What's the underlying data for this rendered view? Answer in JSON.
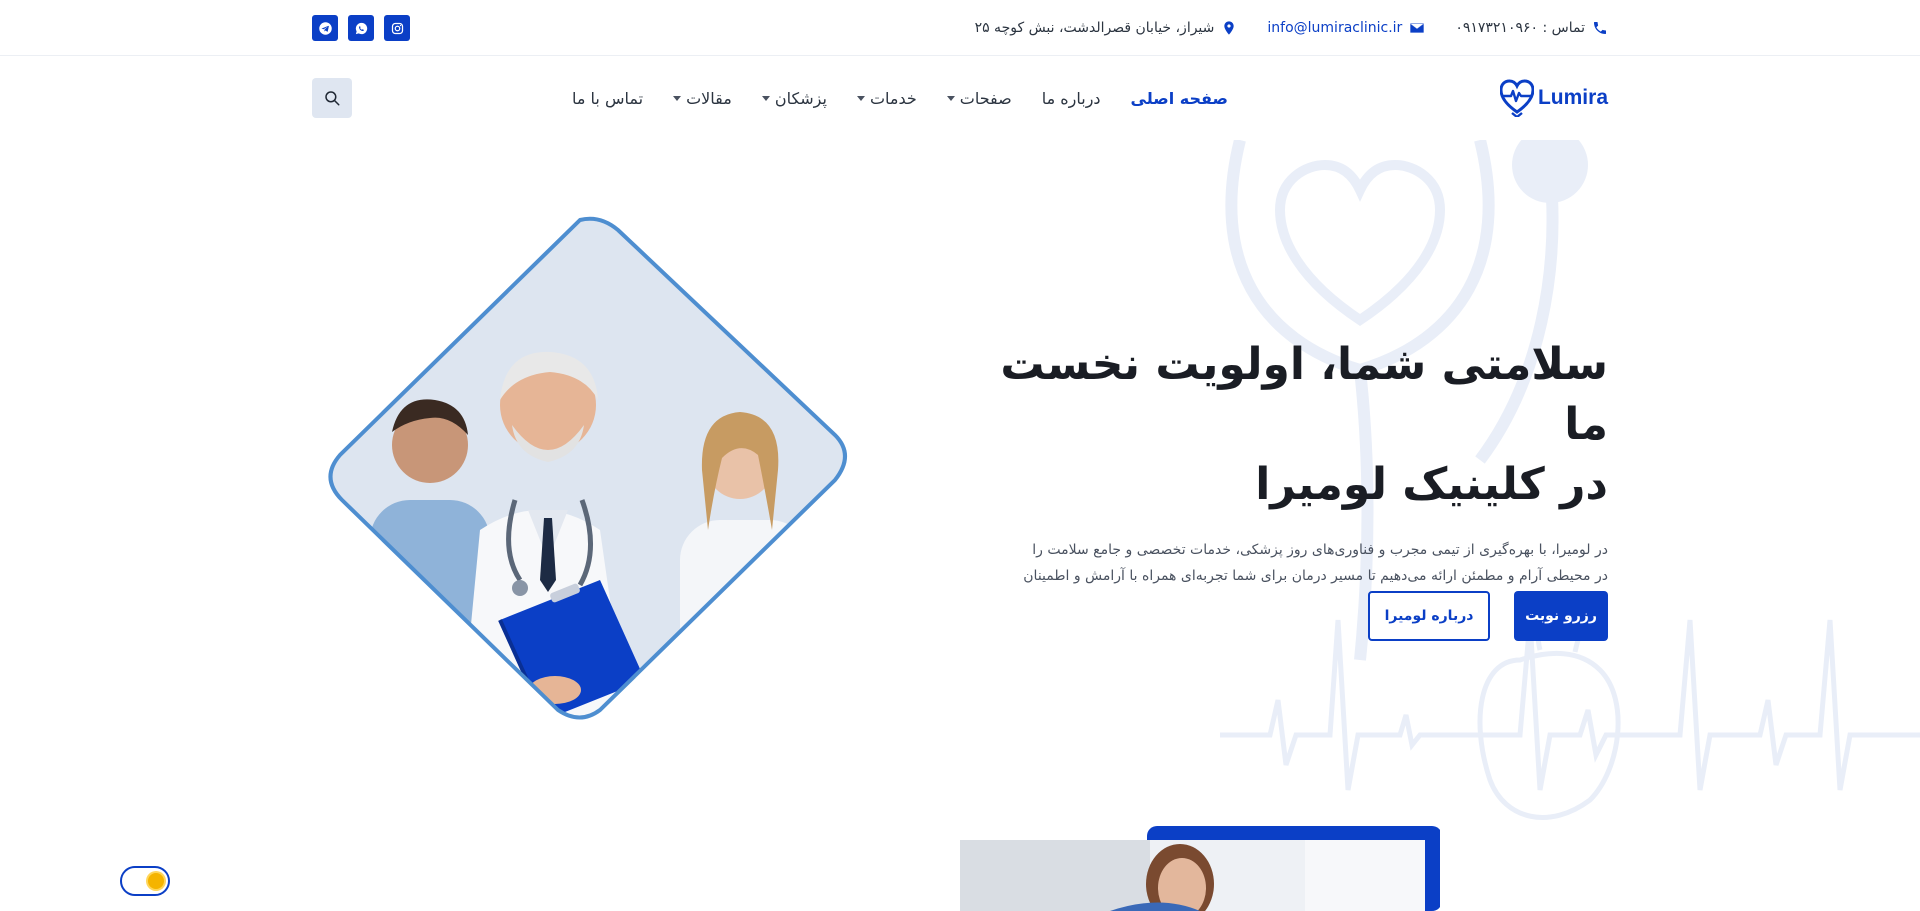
{
  "topbar": {
    "phone": "تماس : ۰۹۱۷۳۲۱۰۹۶۰",
    "email": "info@lumiraclinic.ir",
    "address": "شیراز، خیابان قصرالدشت، نبش کوچه ۲۵",
    "socials": [
      "instagram-icon",
      "whatsapp-icon",
      "telegram-icon"
    ]
  },
  "nav": {
    "brand": "Lumira",
    "items": [
      {
        "label": "صفحه اصلی",
        "active": true,
        "dropdown": false
      },
      {
        "label": "درباره ما",
        "active": false,
        "dropdown": false
      },
      {
        "label": "صفحات",
        "active": false,
        "dropdown": true
      },
      {
        "label": "خدمات",
        "active": false,
        "dropdown": true
      },
      {
        "label": "پزشکان",
        "active": false,
        "dropdown": true
      },
      {
        "label": "مقالات",
        "active": false,
        "dropdown": true
      },
      {
        "label": "تماس با ما",
        "active": false,
        "dropdown": false
      }
    ]
  },
  "hero": {
    "title_line1": "سلامتی شما، اولویت نخست ما",
    "title_line2": "در کلینیک لومیرا",
    "description": "در لومیرا، با بهره‌گیری از تیمی مجرب و فناوری‌های روز پزشکی، خدمات تخصصی و جامع سلامت را در محیطی آرام و مطمئن ارائه می‌دهیم تا مسیر درمان برای شما تجربه‌ای همراه با آرامش و اطمینان باشد.",
    "primary_button": "رزرو نوبت",
    "secondary_button": "درباره لومیرا"
  },
  "colors": {
    "accent": "#0b3fc6",
    "bg_art": "#e9eef8",
    "search_bg": "#dfe6f1"
  }
}
